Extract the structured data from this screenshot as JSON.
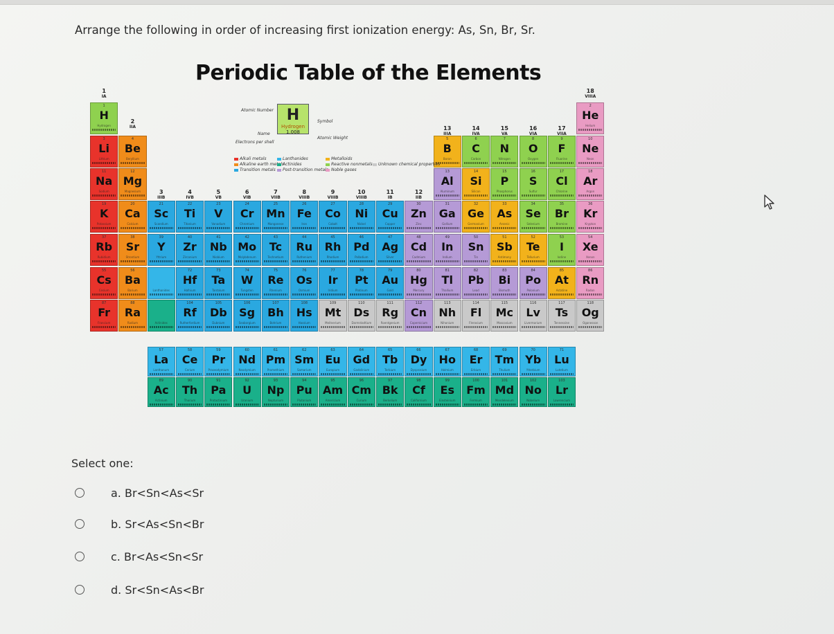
{
  "question": "Arrange the following in order of increasing first ionization energy: As, Sn, Br, Sr.",
  "table_title": "Periodic Table of the Elements",
  "select_label": "Select one:",
  "options": [
    {
      "letter": "a.",
      "text": "Br<Sn<As<Sr"
    },
    {
      "letter": "b.",
      "text": "Sr<As<Sn<Br"
    },
    {
      "letter": "c.",
      "text": "Br<As<Sn<Sr"
    },
    {
      "letter": "d.",
      "text": "Sr<Sn<As<Br"
    }
  ],
  "legend": {
    "key_symbol": "H",
    "key_name": "Hydrogen",
    "key_mass": "1.008",
    "atomic_number_label": "Atomic Number",
    "symbol_label": "Symbol",
    "name_label": "Name",
    "atomic_weight_label": "Atomic Weight",
    "electrons_label": "Electrons per shell",
    "categories": [
      {
        "name": "Alkali metals",
        "color": "#e8332b"
      },
      {
        "name": "Alkaline earth metals",
        "color": "#f08c1a"
      },
      {
        "name": "Transition metals",
        "color": "#2aa8e0"
      },
      {
        "name": "Lanthanides",
        "color": "#34b6e8"
      },
      {
        "name": "Actinides",
        "color": "#1ab08a"
      },
      {
        "name": "Post-transition metals",
        "color": "#b59ad6"
      },
      {
        "name": "Metalloids",
        "color": "#f2b21b"
      },
      {
        "name": "Reactive nonmetals",
        "color": "#8fd14f"
      },
      {
        "name": "Noble gases",
        "color": "#e99bc3"
      },
      {
        "name": "Unknown chemical properties",
        "color": "#c9c9c9"
      }
    ]
  },
  "group_labels": [
    {
      "g": "1",
      "r": "IA"
    },
    {
      "g": "2",
      "r": "IIA"
    },
    {
      "g": "3",
      "r": "IIIB"
    },
    {
      "g": "4",
      "r": "IVB"
    },
    {
      "g": "5",
      "r": "VB"
    },
    {
      "g": "6",
      "r": "VIB"
    },
    {
      "g": "7",
      "r": "VIIB"
    },
    {
      "g": "8",
      "r": "VIIIB"
    },
    {
      "g": "9",
      "r": "VIIIB"
    },
    {
      "g": "10",
      "r": "VIIIB"
    },
    {
      "g": "11",
      "r": "IB"
    },
    {
      "g": "12",
      "r": "IIB"
    },
    {
      "g": "13",
      "r": "IIIA"
    },
    {
      "g": "14",
      "r": "IVA"
    },
    {
      "g": "15",
      "r": "VA"
    },
    {
      "g": "16",
      "r": "VIA"
    },
    {
      "g": "17",
      "r": "VIIA"
    },
    {
      "g": "18",
      "r": "VIIIA"
    }
  ],
  "colors": {
    "alkali": "#e8332b",
    "alkaline": "#f08c1a",
    "transition": "#2aa8e0",
    "post": "#b59ad6",
    "metalloid": "#f2b21b",
    "nonmetal": "#8fd14f",
    "noble": "#e99bc3",
    "lanthanide": "#34b6e8",
    "actinide": "#1ab08a"
  },
  "elements": [
    {
      "n": 1,
      "s": "H",
      "name": "Hydrogen",
      "col": 1,
      "row": 1,
      "c": "nonmetal"
    },
    {
      "n": 2,
      "s": "He",
      "name": "Helium",
      "col": 18,
      "row": 1,
      "c": "noble"
    },
    {
      "n": 3,
      "s": "Li",
      "name": "Lithium",
      "col": 1,
      "row": 2,
      "c": "alkali"
    },
    {
      "n": 4,
      "s": "Be",
      "name": "Beryllium",
      "col": 2,
      "row": 2,
      "c": "alkaline"
    },
    {
      "n": 5,
      "s": "B",
      "name": "Boron",
      "col": 13,
      "row": 2,
      "c": "metalloid"
    },
    {
      "n": 6,
      "s": "C",
      "name": "Carbon",
      "col": 14,
      "row": 2,
      "c": "nonmetal"
    },
    {
      "n": 7,
      "s": "N",
      "name": "Nitrogen",
      "col": 15,
      "row": 2,
      "c": "nonmetal"
    },
    {
      "n": 8,
      "s": "O",
      "name": "Oxygen",
      "col": 16,
      "row": 2,
      "c": "nonmetal"
    },
    {
      "n": 9,
      "s": "F",
      "name": "Fluorine",
      "col": 17,
      "row": 2,
      "c": "nonmetal"
    },
    {
      "n": 10,
      "s": "Ne",
      "name": "Neon",
      "col": 18,
      "row": 2,
      "c": "noble"
    },
    {
      "n": 11,
      "s": "Na",
      "name": "Sodium",
      "col": 1,
      "row": 3,
      "c": "alkali"
    },
    {
      "n": 12,
      "s": "Mg",
      "name": "Magnesium",
      "col": 2,
      "row": 3,
      "c": "alkaline"
    },
    {
      "n": 13,
      "s": "Al",
      "name": "Aluminum",
      "col": 13,
      "row": 3,
      "c": "post"
    },
    {
      "n": 14,
      "s": "Si",
      "name": "Silicon",
      "col": 14,
      "row": 3,
      "c": "metalloid"
    },
    {
      "n": 15,
      "s": "P",
      "name": "Phosphorus",
      "col": 15,
      "row": 3,
      "c": "nonmetal"
    },
    {
      "n": 16,
      "s": "S",
      "name": "Sulfur",
      "col": 16,
      "row": 3,
      "c": "nonmetal"
    },
    {
      "n": 17,
      "s": "Cl",
      "name": "Chlorine",
      "col": 17,
      "row": 3,
      "c": "nonmetal"
    },
    {
      "n": 18,
      "s": "Ar",
      "name": "Argon",
      "col": 18,
      "row": 3,
      "c": "noble"
    },
    {
      "n": 19,
      "s": "K",
      "name": "Potassium",
      "col": 1,
      "row": 4,
      "c": "alkali"
    },
    {
      "n": 20,
      "s": "Ca",
      "name": "Calcium",
      "col": 2,
      "row": 4,
      "c": "alkaline"
    },
    {
      "n": 21,
      "s": "Sc",
      "name": "Scandium",
      "col": 3,
      "row": 4,
      "c": "transition"
    },
    {
      "n": 22,
      "s": "Ti",
      "name": "Titanium",
      "col": 4,
      "row": 4,
      "c": "transition"
    },
    {
      "n": 23,
      "s": "V",
      "name": "Vanadium",
      "col": 5,
      "row": 4,
      "c": "transition"
    },
    {
      "n": 24,
      "s": "Cr",
      "name": "Chromium",
      "col": 6,
      "row": 4,
      "c": "transition"
    },
    {
      "n": 25,
      "s": "Mn",
      "name": "Manganese",
      "col": 7,
      "row": 4,
      "c": "transition"
    },
    {
      "n": 26,
      "s": "Fe",
      "name": "Iron",
      "col": 8,
      "row": 4,
      "c": "transition"
    },
    {
      "n": 27,
      "s": "Co",
      "name": "Cobalt",
      "col": 9,
      "row": 4,
      "c": "transition"
    },
    {
      "n": 28,
      "s": "Ni",
      "name": "Nickel",
      "col": 10,
      "row": 4,
      "c": "transition"
    },
    {
      "n": 29,
      "s": "Cu",
      "name": "Copper",
      "col": 11,
      "row": 4,
      "c": "transition"
    },
    {
      "n": 30,
      "s": "Zn",
      "name": "Zinc",
      "col": 12,
      "row": 4,
      "c": "post"
    },
    {
      "n": 31,
      "s": "Ga",
      "name": "Gallium",
      "col": 13,
      "row": 4,
      "c": "post"
    },
    {
      "n": 32,
      "s": "Ge",
      "name": "Germanium",
      "col": 14,
      "row": 4,
      "c": "metalloid"
    },
    {
      "n": 33,
      "s": "As",
      "name": "Arsenic",
      "col": 15,
      "row": 4,
      "c": "metalloid"
    },
    {
      "n": 34,
      "s": "Se",
      "name": "Selenium",
      "col": 16,
      "row": 4,
      "c": "nonmetal"
    },
    {
      "n": 35,
      "s": "Br",
      "name": "Bromine",
      "col": 17,
      "row": 4,
      "c": "nonmetal"
    },
    {
      "n": 36,
      "s": "Kr",
      "name": "Krypton",
      "col": 18,
      "row": 4,
      "c": "noble"
    },
    {
      "n": 37,
      "s": "Rb",
      "name": "Rubidium",
      "col": 1,
      "row": 5,
      "c": "alkali"
    },
    {
      "n": 38,
      "s": "Sr",
      "name": "Strontium",
      "col": 2,
      "row": 5,
      "c": "alkaline"
    },
    {
      "n": 39,
      "s": "Y",
      "name": "Yttrium",
      "col": 3,
      "row": 5,
      "c": "transition"
    },
    {
      "n": 40,
      "s": "Zr",
      "name": "Zirconium",
      "col": 4,
      "row": 5,
      "c": "transition"
    },
    {
      "n": 41,
      "s": "Nb",
      "name": "Niobium",
      "col": 5,
      "row": 5,
      "c": "transition"
    },
    {
      "n": 42,
      "s": "Mo",
      "name": "Molybdenum",
      "col": 6,
      "row": 5,
      "c": "transition"
    },
    {
      "n": 43,
      "s": "Tc",
      "name": "Technetium",
      "col": 7,
      "row": 5,
      "c": "transition"
    },
    {
      "n": 44,
      "s": "Ru",
      "name": "Ruthenium",
      "col": 8,
      "row": 5,
      "c": "transition"
    },
    {
      "n": 45,
      "s": "Rh",
      "name": "Rhodium",
      "col": 9,
      "row": 5,
      "c": "transition"
    },
    {
      "n": 46,
      "s": "Pd",
      "name": "Palladium",
      "col": 10,
      "row": 5,
      "c": "transition"
    },
    {
      "n": 47,
      "s": "Ag",
      "name": "Silver",
      "col": 11,
      "row": 5,
      "c": "transition"
    },
    {
      "n": 48,
      "s": "Cd",
      "name": "Cadmium",
      "col": 12,
      "row": 5,
      "c": "post"
    },
    {
      "n": 49,
      "s": "In",
      "name": "Indium",
      "col": 13,
      "row": 5,
      "c": "post"
    },
    {
      "n": 50,
      "s": "Sn",
      "name": "Tin",
      "col": 14,
      "row": 5,
      "c": "post"
    },
    {
      "n": 51,
      "s": "Sb",
      "name": "Antimony",
      "col": 15,
      "row": 5,
      "c": "metalloid"
    },
    {
      "n": 52,
      "s": "Te",
      "name": "Tellurium",
      "col": 16,
      "row": 5,
      "c": "metalloid"
    },
    {
      "n": 53,
      "s": "I",
      "name": "Iodine",
      "col": 17,
      "row": 5,
      "c": "nonmetal"
    },
    {
      "n": 54,
      "s": "Xe",
      "name": "Xenon",
      "col": 18,
      "row": 5,
      "c": "noble"
    },
    {
      "n": 55,
      "s": "Cs",
      "name": "Cesium",
      "col": 1,
      "row": 6,
      "c": "alkali"
    },
    {
      "n": 56,
      "s": "Ba",
      "name": "Barium",
      "col": 2,
      "row": 6,
      "c": "alkaline"
    },
    {
      "n": 0,
      "s": "",
      "name": "Lanthanides",
      "col": 3,
      "row": 6,
      "c": "lanthanide"
    },
    {
      "n": 72,
      "s": "Hf",
      "name": "Hafnium",
      "col": 4,
      "row": 6,
      "c": "transition"
    },
    {
      "n": 73,
      "s": "Ta",
      "name": "Tantalum",
      "col": 5,
      "row": 6,
      "c": "transition"
    },
    {
      "n": 74,
      "s": "W",
      "name": "Tungsten",
      "col": 6,
      "row": 6,
      "c": "transition"
    },
    {
      "n": 75,
      "s": "Re",
      "name": "Rhenium",
      "col": 7,
      "row": 6,
      "c": "transition"
    },
    {
      "n": 76,
      "s": "Os",
      "name": "Osmium",
      "col": 8,
      "row": 6,
      "c": "transition"
    },
    {
      "n": 77,
      "s": "Ir",
      "name": "Iridium",
      "col": 9,
      "row": 6,
      "c": "transition"
    },
    {
      "n": 78,
      "s": "Pt",
      "name": "Platinum",
      "col": 10,
      "row": 6,
      "c": "transition"
    },
    {
      "n": 79,
      "s": "Au",
      "name": "Gold",
      "col": 11,
      "row": 6,
      "c": "transition"
    },
    {
      "n": 80,
      "s": "Hg",
      "name": "Mercury",
      "col": 12,
      "row": 6,
      "c": "post"
    },
    {
      "n": 81,
      "s": "Tl",
      "name": "Thallium",
      "col": 13,
      "row": 6,
      "c": "post"
    },
    {
      "n": 82,
      "s": "Pb",
      "name": "Lead",
      "col": 14,
      "row": 6,
      "c": "post"
    },
    {
      "n": 83,
      "s": "Bi",
      "name": "Bismuth",
      "col": 15,
      "row": 6,
      "c": "post"
    },
    {
      "n": 84,
      "s": "Po",
      "name": "Polonium",
      "col": 16,
      "row": 6,
      "c": "post"
    },
    {
      "n": 85,
      "s": "At",
      "name": "Astatine",
      "col": 17,
      "row": 6,
      "c": "metalloid"
    },
    {
      "n": 86,
      "s": "Rn",
      "name": "Radon",
      "col": 18,
      "row": 6,
      "c": "noble"
    },
    {
      "n": 87,
      "s": "Fr",
      "name": "Francium",
      "col": 1,
      "row": 7,
      "c": "alkali"
    },
    {
      "n": 88,
      "s": "Ra",
      "name": "Radium",
      "col": 2,
      "row": 7,
      "c": "alkaline"
    },
    {
      "n": 0,
      "s": "",
      "name": "Actinides",
      "col": 3,
      "row": 7,
      "c": "actinide"
    },
    {
      "n": 104,
      "s": "Rf",
      "name": "Rutherfordium",
      "col": 4,
      "row": 7,
      "c": "transition"
    },
    {
      "n": 105,
      "s": "Db",
      "name": "Dubnium",
      "col": 5,
      "row": 7,
      "c": "transition"
    },
    {
      "n": 106,
      "s": "Sg",
      "name": "Seaborgium",
      "col": 6,
      "row": 7,
      "c": "transition"
    },
    {
      "n": 107,
      "s": "Bh",
      "name": "Bohrium",
      "col": 7,
      "row": 7,
      "c": "transition"
    },
    {
      "n": 108,
      "s": "Hs",
      "name": "Hassium",
      "col": 8,
      "row": 7,
      "c": "transition"
    },
    {
      "n": 109,
      "s": "Mt",
      "name": "Meitnerium",
      "col": 9,
      "row": 7,
      "c": "unknown"
    },
    {
      "n": 110,
      "s": "Ds",
      "name": "Darmstadtium",
      "col": 10,
      "row": 7,
      "c": "unknown"
    },
    {
      "n": 111,
      "s": "Rg",
      "name": "Roentgenium",
      "col": 11,
      "row": 7,
      "c": "unknown"
    },
    {
      "n": 112,
      "s": "Cn",
      "name": "Copernicium",
      "col": 12,
      "row": 7,
      "c": "post"
    },
    {
      "n": 113,
      "s": "Nh",
      "name": "Nihonium",
      "col": 13,
      "row": 7,
      "c": "unknown"
    },
    {
      "n": 114,
      "s": "Fl",
      "name": "Flerovium",
      "col": 14,
      "row": 7,
      "c": "unknown"
    },
    {
      "n": 115,
      "s": "Mc",
      "name": "Moscovium",
      "col": 15,
      "row": 7,
      "c": "unknown"
    },
    {
      "n": 116,
      "s": "Lv",
      "name": "Livermorium",
      "col": 16,
      "row": 7,
      "c": "unknown"
    },
    {
      "n": 117,
      "s": "Ts",
      "name": "Tennessine",
      "col": 17,
      "row": 7,
      "c": "unknown"
    },
    {
      "n": 118,
      "s": "Og",
      "name": "Oganesson",
      "col": 18,
      "row": 7,
      "c": "unknown"
    },
    {
      "n": 57,
      "s": "La",
      "name": "Lanthanum",
      "col": 3,
      "row": 9,
      "c": "lanthanide"
    },
    {
      "n": 58,
      "s": "Ce",
      "name": "Cerium",
      "col": 4,
      "row": 9,
      "c": "lanthanide"
    },
    {
      "n": 59,
      "s": "Pr",
      "name": "Praseodymium",
      "col": 5,
      "row": 9,
      "c": "lanthanide"
    },
    {
      "n": 60,
      "s": "Nd",
      "name": "Neodymium",
      "col": 6,
      "row": 9,
      "c": "lanthanide"
    },
    {
      "n": 61,
      "s": "Pm",
      "name": "Promethium",
      "col": 7,
      "row": 9,
      "c": "lanthanide"
    },
    {
      "n": 62,
      "s": "Sm",
      "name": "Samarium",
      "col": 8,
      "row": 9,
      "c": "lanthanide"
    },
    {
      "n": 63,
      "s": "Eu",
      "name": "Europium",
      "col": 9,
      "row": 9,
      "c": "lanthanide"
    },
    {
      "n": 64,
      "s": "Gd",
      "name": "Gadolinium",
      "col": 10,
      "row": 9,
      "c": "lanthanide"
    },
    {
      "n": 65,
      "s": "Tb",
      "name": "Terbium",
      "col": 11,
      "row": 9,
      "c": "lanthanide"
    },
    {
      "n": 66,
      "s": "Dy",
      "name": "Dysprosium",
      "col": 12,
      "row": 9,
      "c": "lanthanide"
    },
    {
      "n": 67,
      "s": "Ho",
      "name": "Holmium",
      "col": 13,
      "row": 9,
      "c": "lanthanide"
    },
    {
      "n": 68,
      "s": "Er",
      "name": "Erbium",
      "col": 14,
      "row": 9,
      "c": "lanthanide"
    },
    {
      "n": 69,
      "s": "Tm",
      "name": "Thulium",
      "col": 15,
      "row": 9,
      "c": "lanthanide"
    },
    {
      "n": 70,
      "s": "Yb",
      "name": "Ytterbium",
      "col": 16,
      "row": 9,
      "c": "lanthanide"
    },
    {
      "n": 71,
      "s": "Lu",
      "name": "Lutetium",
      "col": 17,
      "row": 9,
      "c": "lanthanide"
    },
    {
      "n": 89,
      "s": "Ac",
      "name": "Actinium",
      "col": 3,
      "row": 10,
      "c": "actinide"
    },
    {
      "n": 90,
      "s": "Th",
      "name": "Thorium",
      "col": 4,
      "row": 10,
      "c": "actinide"
    },
    {
      "n": 91,
      "s": "Pa",
      "name": "Protactinium",
      "col": 5,
      "row": 10,
      "c": "actinide"
    },
    {
      "n": 92,
      "s": "U",
      "name": "Uranium",
      "col": 6,
      "row": 10,
      "c": "actinide"
    },
    {
      "n": 93,
      "s": "Np",
      "name": "Neptunium",
      "col": 7,
      "row": 10,
      "c": "actinide"
    },
    {
      "n": 94,
      "s": "Pu",
      "name": "Plutonium",
      "col": 8,
      "row": 10,
      "c": "actinide"
    },
    {
      "n": 95,
      "s": "Am",
      "name": "Americium",
      "col": 9,
      "row": 10,
      "c": "actinide"
    },
    {
      "n": 96,
      "s": "Cm",
      "name": "Curium",
      "col": 10,
      "row": 10,
      "c": "actinide"
    },
    {
      "n": 97,
      "s": "Bk",
      "name": "Berkelium",
      "col": 11,
      "row": 10,
      "c": "actinide"
    },
    {
      "n": 98,
      "s": "Cf",
      "name": "Californium",
      "col": 12,
      "row": 10,
      "c": "actinide"
    },
    {
      "n": 99,
      "s": "Es",
      "name": "Einsteinium",
      "col": 13,
      "row": 10,
      "c": "actinide"
    },
    {
      "n": 100,
      "s": "Fm",
      "name": "Fermium",
      "col": 14,
      "row": 10,
      "c": "actinide"
    },
    {
      "n": 101,
      "s": "Md",
      "name": "Mendelevium",
      "col": 15,
      "row": 10,
      "c": "actinide"
    },
    {
      "n": 102,
      "s": "No",
      "name": "Nobelium",
      "col": 16,
      "row": 10,
      "c": "actinide"
    },
    {
      "n": 103,
      "s": "Lr",
      "name": "Lawrencium",
      "col": 17,
      "row": 10,
      "c": "actinide"
    }
  ]
}
